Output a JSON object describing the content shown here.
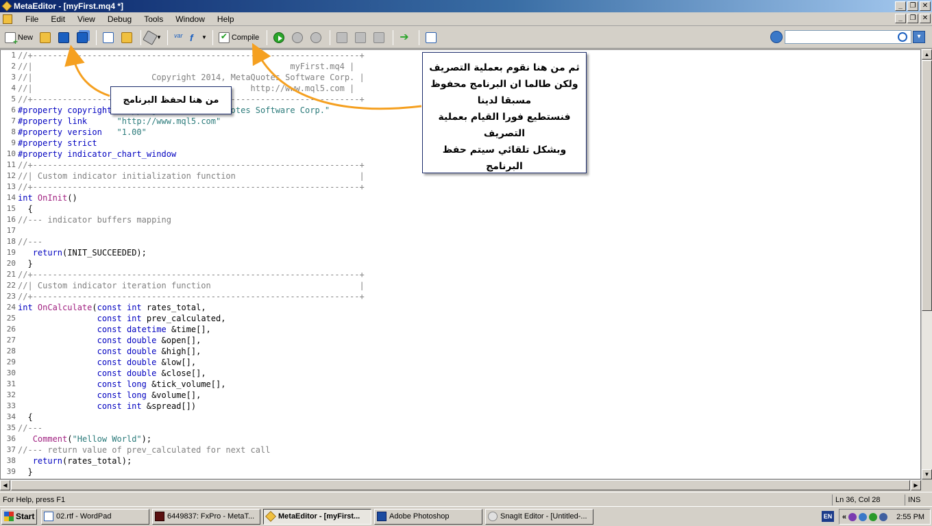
{
  "window": {
    "title": "MetaEditor - [myFirst.mq4 *]"
  },
  "menu": [
    "File",
    "Edit",
    "View",
    "Debug",
    "Tools",
    "Window",
    "Help"
  ],
  "toolbar": {
    "new_label": "New",
    "compile_label": "Compile",
    "var_label": "var",
    "fn_label": "f",
    "search_placeholder": ""
  },
  "editor": {
    "lines": [
      {
        "n": "1",
        "parts": [
          [
            "c",
            "//+------------------------------------------------------------------+"
          ]
        ]
      },
      {
        "n": "2",
        "parts": [
          [
            "c",
            "//|                                                    myFirst.mq4 |"
          ]
        ]
      },
      {
        "n": "3",
        "parts": [
          [
            "c",
            "//|                        Copyright 2014, MetaQuotes Software Corp. |"
          ]
        ]
      },
      {
        "n": "4",
        "parts": [
          [
            "c",
            "//|                                            http://www.mql5.com |"
          ]
        ]
      },
      {
        "n": "5",
        "parts": [
          [
            "c",
            "//+------------------------------------------------------------------+"
          ]
        ]
      },
      {
        "n": "6",
        "parts": [
          [
            "k",
            "#property copyright "
          ],
          [
            "s",
            "\"Copyright 2014, MetaQuotes Software Corp.\""
          ]
        ]
      },
      {
        "n": "7",
        "parts": [
          [
            "k",
            "#property link      "
          ],
          [
            "s",
            "\"http://www.mql5.com\""
          ]
        ]
      },
      {
        "n": "8",
        "parts": [
          [
            "k",
            "#property version   "
          ],
          [
            "s",
            "\"1.00\""
          ]
        ]
      },
      {
        "n": "9",
        "parts": [
          [
            "k",
            "#property strict"
          ]
        ]
      },
      {
        "n": "10",
        "parts": [
          [
            "k",
            "#property indicator_chart_window"
          ]
        ]
      },
      {
        "n": "11",
        "parts": [
          [
            "c",
            "//+------------------------------------------------------------------+"
          ]
        ]
      },
      {
        "n": "12",
        "parts": [
          [
            "c",
            "//| Custom indicator initialization function                         |"
          ]
        ]
      },
      {
        "n": "13",
        "parts": [
          [
            "c",
            "//+------------------------------------------------------------------+"
          ]
        ]
      },
      {
        "n": "14",
        "parts": [
          [
            "k",
            "int "
          ],
          [
            "f",
            "OnInit"
          ],
          [
            "t",
            "()"
          ]
        ]
      },
      {
        "n": "15",
        "parts": [
          [
            "t",
            "  {"
          ]
        ]
      },
      {
        "n": "16",
        "parts": [
          [
            "c",
            "//--- indicator buffers mapping"
          ]
        ]
      },
      {
        "n": "17",
        "parts": [
          [
            "t",
            ""
          ]
        ]
      },
      {
        "n": "18",
        "parts": [
          [
            "c",
            "//---"
          ]
        ]
      },
      {
        "n": "19",
        "parts": [
          [
            "t",
            "   "
          ],
          [
            "k",
            "return"
          ],
          [
            "t",
            "(INIT_SUCCEEDED);"
          ]
        ]
      },
      {
        "n": "20",
        "parts": [
          [
            "t",
            "  }"
          ]
        ]
      },
      {
        "n": "21",
        "parts": [
          [
            "c",
            "//+------------------------------------------------------------------+"
          ]
        ]
      },
      {
        "n": "22",
        "parts": [
          [
            "c",
            "//| Custom indicator iteration function                              |"
          ]
        ]
      },
      {
        "n": "23",
        "parts": [
          [
            "c",
            "//+------------------------------------------------------------------+"
          ]
        ]
      },
      {
        "n": "24",
        "parts": [
          [
            "k",
            "int "
          ],
          [
            "f",
            "OnCalculate"
          ],
          [
            "t",
            "("
          ],
          [
            "k",
            "const int "
          ],
          [
            "t",
            "rates_total,"
          ]
        ]
      },
      {
        "n": "25",
        "parts": [
          [
            "t",
            "                "
          ],
          [
            "k",
            "const int "
          ],
          [
            "t",
            "prev_calculated,"
          ]
        ]
      },
      {
        "n": "26",
        "parts": [
          [
            "t",
            "                "
          ],
          [
            "k",
            "const datetime "
          ],
          [
            "t",
            "&time[],"
          ]
        ]
      },
      {
        "n": "27",
        "parts": [
          [
            "t",
            "                "
          ],
          [
            "k",
            "const double "
          ],
          [
            "t",
            "&open[],"
          ]
        ]
      },
      {
        "n": "28",
        "parts": [
          [
            "t",
            "                "
          ],
          [
            "k",
            "const double "
          ],
          [
            "t",
            "&high[],"
          ]
        ]
      },
      {
        "n": "29",
        "parts": [
          [
            "t",
            "                "
          ],
          [
            "k",
            "const double "
          ],
          [
            "t",
            "&low[],"
          ]
        ]
      },
      {
        "n": "30",
        "parts": [
          [
            "t",
            "                "
          ],
          [
            "k",
            "const double "
          ],
          [
            "t",
            "&close[],"
          ]
        ]
      },
      {
        "n": "31",
        "parts": [
          [
            "t",
            "                "
          ],
          [
            "k",
            "const long "
          ],
          [
            "t",
            "&tick_volume[],"
          ]
        ]
      },
      {
        "n": "32",
        "parts": [
          [
            "t",
            "                "
          ],
          [
            "k",
            "const long "
          ],
          [
            "t",
            "&volume[],"
          ]
        ]
      },
      {
        "n": "33",
        "parts": [
          [
            "t",
            "                "
          ],
          [
            "k",
            "const int "
          ],
          [
            "t",
            "&spread[])"
          ]
        ]
      },
      {
        "n": "34",
        "parts": [
          [
            "t",
            "  {"
          ]
        ]
      },
      {
        "n": "35",
        "parts": [
          [
            "c",
            "//---"
          ]
        ]
      },
      {
        "n": "36",
        "parts": [
          [
            "t",
            "   "
          ],
          [
            "f",
            "Comment"
          ],
          [
            "t",
            "("
          ],
          [
            "s",
            "\"Hellow World\""
          ],
          [
            "t",
            ");"
          ]
        ]
      },
      {
        "n": "37",
        "parts": [
          [
            "c",
            "//--- return value of prev_calculated for next call"
          ]
        ]
      },
      {
        "n": "38",
        "parts": [
          [
            "t",
            "   "
          ],
          [
            "k",
            "return"
          ],
          [
            "t",
            "(rates_total);"
          ]
        ]
      },
      {
        "n": "39",
        "parts": [
          [
            "t",
            "  }"
          ]
        ]
      }
    ]
  },
  "annotations": {
    "save_note": "من هنا لحفظ البرنامج",
    "compile_note": [
      "ثم من هنا نقوم بعملية التصريف",
      "ولكن طالما ان البرنامج محفوظ",
      "مسبقا لدينا",
      "فنستطيع فورا القيام بعملية",
      "التصريف",
      "وبشكل تلقائي سيتم حفظ البرنامج"
    ]
  },
  "status": {
    "help": "For Help, press F1",
    "position": "Ln 36, Col 28",
    "mode": "INS"
  },
  "taskbar": {
    "start": "Start",
    "buttons": [
      "02.rtf - WordPad",
      "6449837: FxPro - MetaT...",
      "MetaEditor - [myFirst...",
      "Adobe Photoshop",
      "SnagIt Editor - [Untitled-..."
    ],
    "lang": "EN",
    "clock": "2:55 PM"
  },
  "colors": {
    "annotation_arrow": "#f5a020",
    "keyword": "#0000c0",
    "function": "#a02080",
    "string": "#2a7a7a",
    "comment": "#808080"
  }
}
